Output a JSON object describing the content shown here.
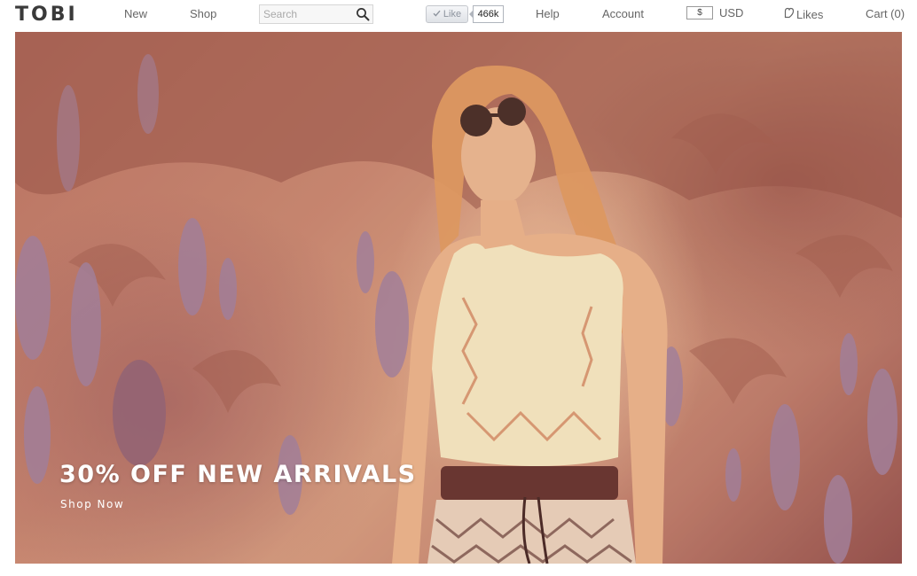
{
  "brand": {
    "logo_text": "TOBI"
  },
  "nav": {
    "new_label": "New",
    "shop_label": "Shop",
    "search_placeholder": "Search",
    "help_label": "Help",
    "account_label": "Account",
    "likes_label": "Likes",
    "cart_label": "Cart (0)"
  },
  "facebook": {
    "like_label": "Like",
    "like_count": "466k"
  },
  "currency": {
    "symbol": "$",
    "code": "USD"
  },
  "hero": {
    "headline": "30% OFF NEW ARRIVALS",
    "cta_label": "Shop Now",
    "image_description": "Woman in white cut-out crop top and sunglasses standing among purple flower spikes, warm red-tinted photo"
  },
  "icons": {
    "search": "search-icon",
    "like_check": "check-icon",
    "likes": "heart-tag-icon"
  },
  "colors": {
    "logo": "#3a3a3a",
    "nav_text": "#666666",
    "hero_text": "#ffffff",
    "hero_tint": "#c48670"
  }
}
